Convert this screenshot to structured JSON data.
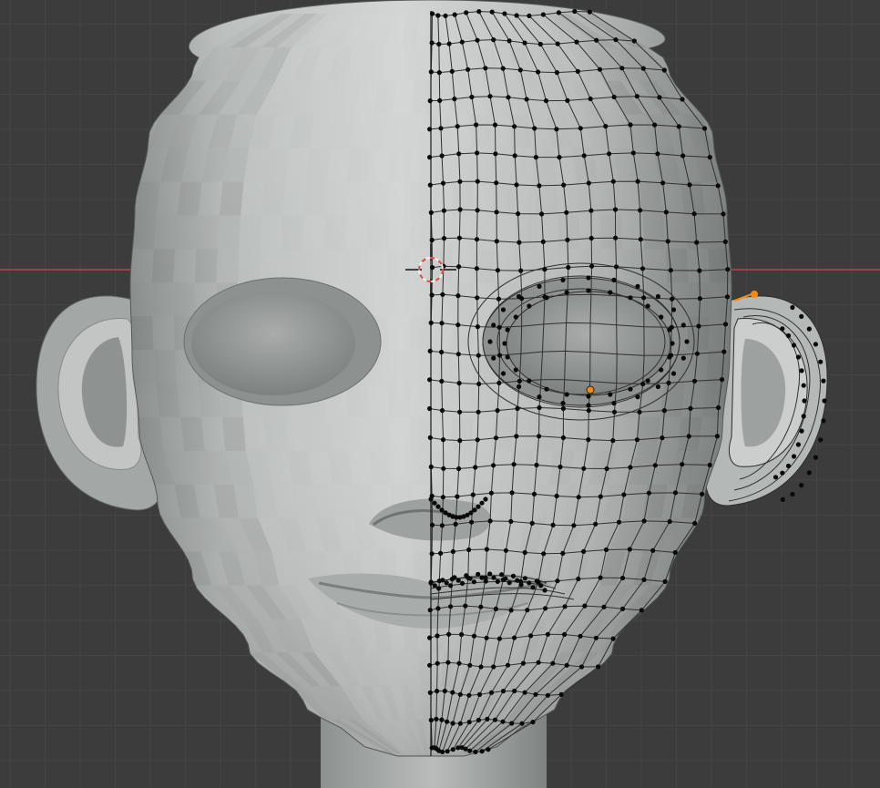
{
  "viewport": {
    "mode": "edit-mode",
    "view": "front-orthographic",
    "shading": "solid",
    "object": "head-mesh",
    "mirror_modifier": true,
    "colors": {
      "background": "#3c3c3c",
      "grid_minor": "#444444",
      "grid_major": "#4a4a4a",
      "x_axis": "#c0404a",
      "mesh_light": "#c9cccb",
      "mesh_mid": "#a7aaa9",
      "mesh_dark": "#6f7473",
      "wire": "#303030",
      "vertex": "#0a0a0a",
      "selected_vertex": "#f08a14",
      "cursor_ring_red": "#d94a4a",
      "cursor_ring_white": "#f0f0f0"
    },
    "icons": {
      "cursor": "3d-cursor-icon",
      "vertex": "vertex-dot-icon",
      "selected": "selected-vertex-icon"
    }
  }
}
